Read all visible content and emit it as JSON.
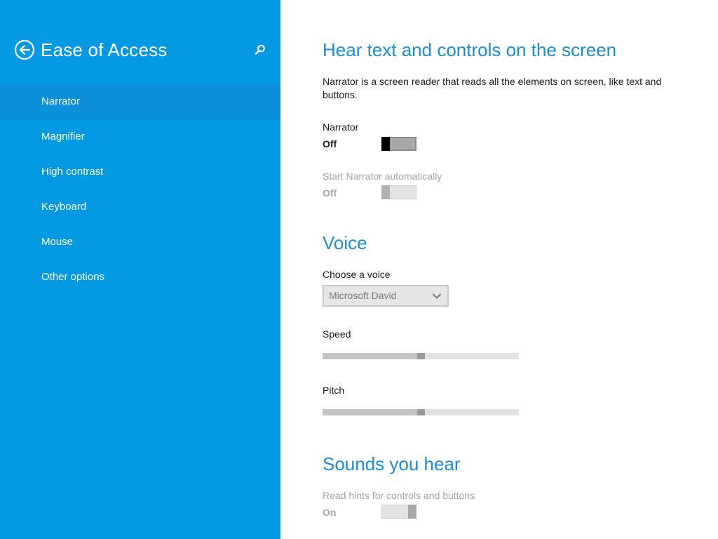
{
  "sidebar": {
    "title": "Ease of Access",
    "back_icon": "back-arrow-circle-icon",
    "search_icon": "search-icon",
    "background_color": "#0399e3",
    "selected_color": "#0b90d9",
    "items": [
      {
        "label": "Narrator",
        "selected": true
      },
      {
        "label": "Magnifier",
        "selected": false
      },
      {
        "label": "High contrast",
        "selected": false
      },
      {
        "label": "Keyboard",
        "selected": false
      },
      {
        "label": "Mouse",
        "selected": false
      },
      {
        "label": "Other options",
        "selected": false
      }
    ]
  },
  "main": {
    "accent_color": "#1a8fd6",
    "section_hear": {
      "heading": "Hear text and controls on the screen",
      "description": "Narrator is a screen reader that reads all the elements on screen, like text and buttons.",
      "narrator_toggle": {
        "label": "Narrator",
        "state": "Off",
        "on": false,
        "enabled": true
      },
      "start_auto_toggle": {
        "label": "Start Narrator automatically",
        "state": "Off",
        "on": false,
        "enabled": false
      }
    },
    "section_voice": {
      "heading": "Voice",
      "choose_voice": {
        "label": "Choose a voice",
        "selected": "Microsoft David",
        "enabled": false
      },
      "speed": {
        "label": "Speed",
        "value": 0.5,
        "enabled": false
      },
      "pitch": {
        "label": "Pitch",
        "value": 0.5,
        "enabled": false
      }
    },
    "section_sounds": {
      "heading": "Sounds you hear",
      "read_hints_toggle": {
        "label": "Read hints for controls and buttons",
        "state": "On",
        "on": true,
        "enabled": false
      }
    }
  }
}
